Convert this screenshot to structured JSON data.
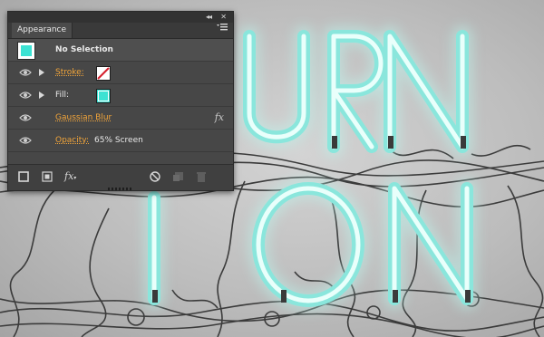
{
  "artwork": {
    "neon_color": "#8ae6dc",
    "glow_color": "#baf6ee",
    "wire_color": "#3b3b3b",
    "background_color": "#c4c4c4"
  },
  "panel": {
    "title_controls": {
      "collapse_icon": "double-chevron-left-icon",
      "close_icon": "close-icon"
    },
    "tab": {
      "label": "Appearance",
      "close_icon": "close-icon"
    },
    "menu_icon": "panel-menu-icon",
    "rows": {
      "selection": {
        "label": "No Selection",
        "thumbnail_color": "#3ce2d3"
      },
      "stroke": {
        "label": "Stroke:",
        "swatch": "none"
      },
      "fill": {
        "label": "Fill:",
        "swatch_color": "#3ce2d3"
      },
      "effect": {
        "label": "Gaussian Blur",
        "fx_label": "fx"
      },
      "opacity": {
        "label": "Opacity:",
        "value": "65% Screen"
      }
    },
    "bottom_toolbar": {
      "add_stroke": "add-stroke-icon",
      "add_fill": "add-fill-icon",
      "add_effect": {
        "label": "fx",
        "icon": "fx-menu-icon"
      },
      "clear": "clear-appearance-icon",
      "duplicate": "duplicate-item-icon",
      "delete": "trash-icon"
    },
    "accent_link_color": "#f2a53a"
  }
}
